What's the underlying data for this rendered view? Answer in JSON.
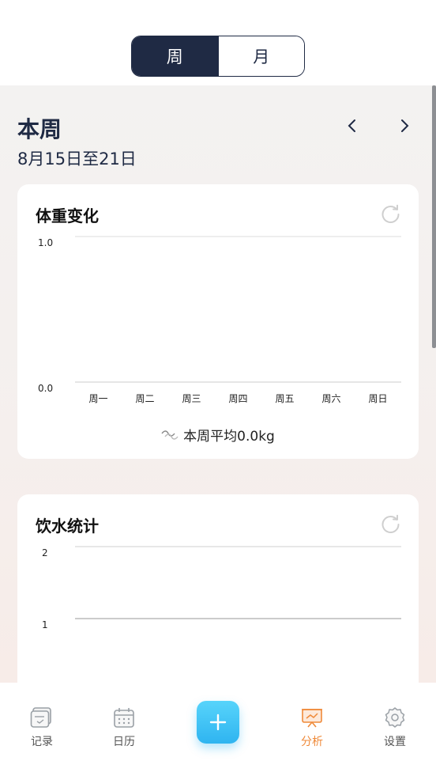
{
  "segment": {
    "week_label": "周",
    "month_label": "月",
    "selected": "week"
  },
  "header": {
    "title": "本周",
    "range": "8月15日至21日"
  },
  "weight_card": {
    "title": "体重变化",
    "average_text": "本周平均0.0kg",
    "chart_data": {
      "type": "line",
      "categories": [
        "周一",
        "周二",
        "周三",
        "周四",
        "周五",
        "周六",
        "周日"
      ],
      "series": [],
      "ylim": [
        0.0,
        1.0
      ],
      "yticks": [
        "1.0",
        "0.0"
      ],
      "grid": true
    }
  },
  "water_card": {
    "title": "饮水统计",
    "chart_data": {
      "type": "bar",
      "yticks": [
        "2",
        "1"
      ],
      "series": [],
      "grid": true
    }
  },
  "bottom_nav": {
    "items": [
      {
        "label": "记录",
        "icon": "record-icon"
      },
      {
        "label": "日历",
        "icon": "calendar-icon"
      },
      {
        "label": "分析",
        "icon": "analysis-icon",
        "active": true
      },
      {
        "label": "设置",
        "icon": "settings-icon"
      }
    ],
    "add_icon": "plus-icon"
  },
  "colors": {
    "navy": "#1f2a44",
    "accent": "#ef8a3a",
    "fab": "#3bbcf3"
  }
}
